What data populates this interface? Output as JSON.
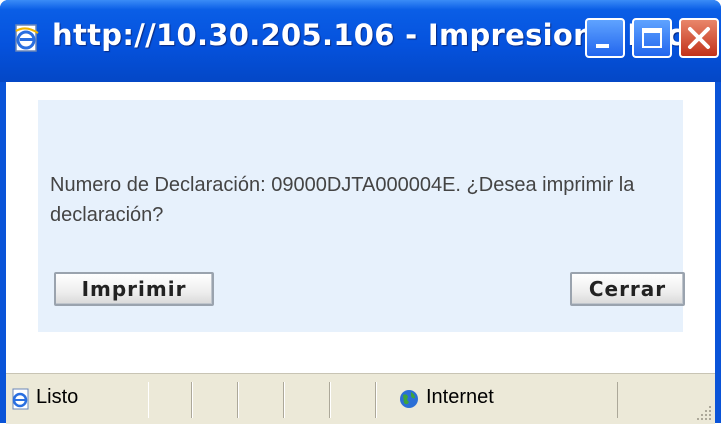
{
  "window": {
    "title": "http://10.30.205.106 - Impresion - Mic...",
    "icon": "ie-page-icon",
    "controls": [
      "minimize-icon",
      "maximize-icon",
      "close-icon"
    ]
  },
  "dialog": {
    "message": "Numero de Declaración: 09000DJTA000004E. ¿Desea imprimir la declaración?",
    "print_label": "Imprimir",
    "close_label": "Cerrar"
  },
  "statusbar": {
    "status_text": "Listo",
    "zone_text": "Internet",
    "status_icon": "ie-page-icon",
    "zone_icon": "globe-icon"
  },
  "colors": {
    "titlebar": "#0552dd",
    "panel": "#e7f1fc",
    "close_button": "#c2321a"
  }
}
